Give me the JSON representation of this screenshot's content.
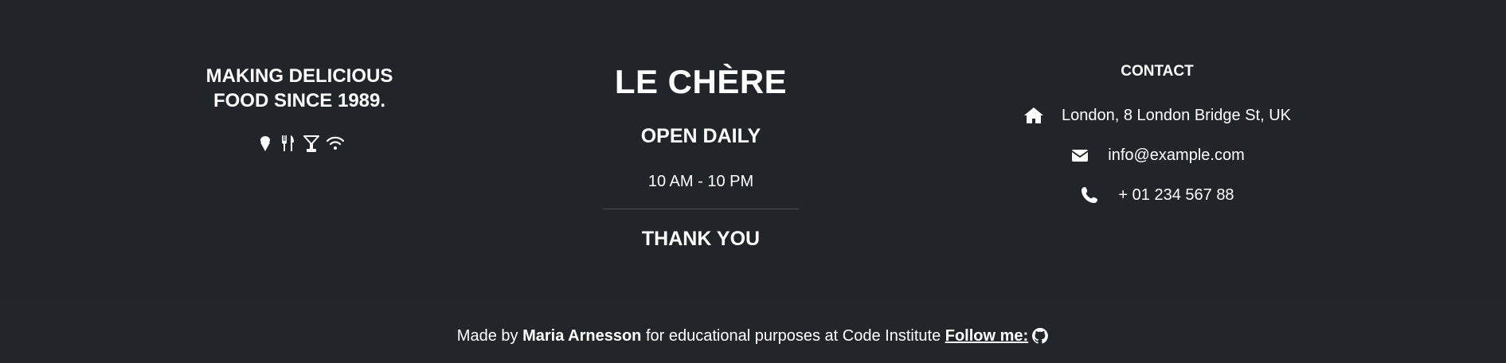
{
  "left": {
    "tagline_line1": "MAKING DELICIOUS",
    "tagline_line2": "FOOD SINCE 1989.",
    "icons": [
      "ice-cream-icon",
      "utensils-icon",
      "cocktail-icon",
      "wifi-icon"
    ]
  },
  "middle": {
    "brand": "LE CHÈRE",
    "open_title": "OPEN DAILY",
    "hours": "10 AM - 10 PM",
    "thanks": "THANK YOU"
  },
  "contact": {
    "title": "CONTACT",
    "address": "London, 8 London Bridge St, UK",
    "email": "info@example.com",
    "phone": "+ 01 234 567 88"
  },
  "bottom": {
    "made_by": "Made by",
    "author": "Maria Arnesson",
    "purpose": "for educational purposes at Code Institute",
    "follow": "Follow me:"
  },
  "colors": {
    "background": "#212429",
    "text": "#ffffff",
    "divider": "#4a4d52"
  }
}
